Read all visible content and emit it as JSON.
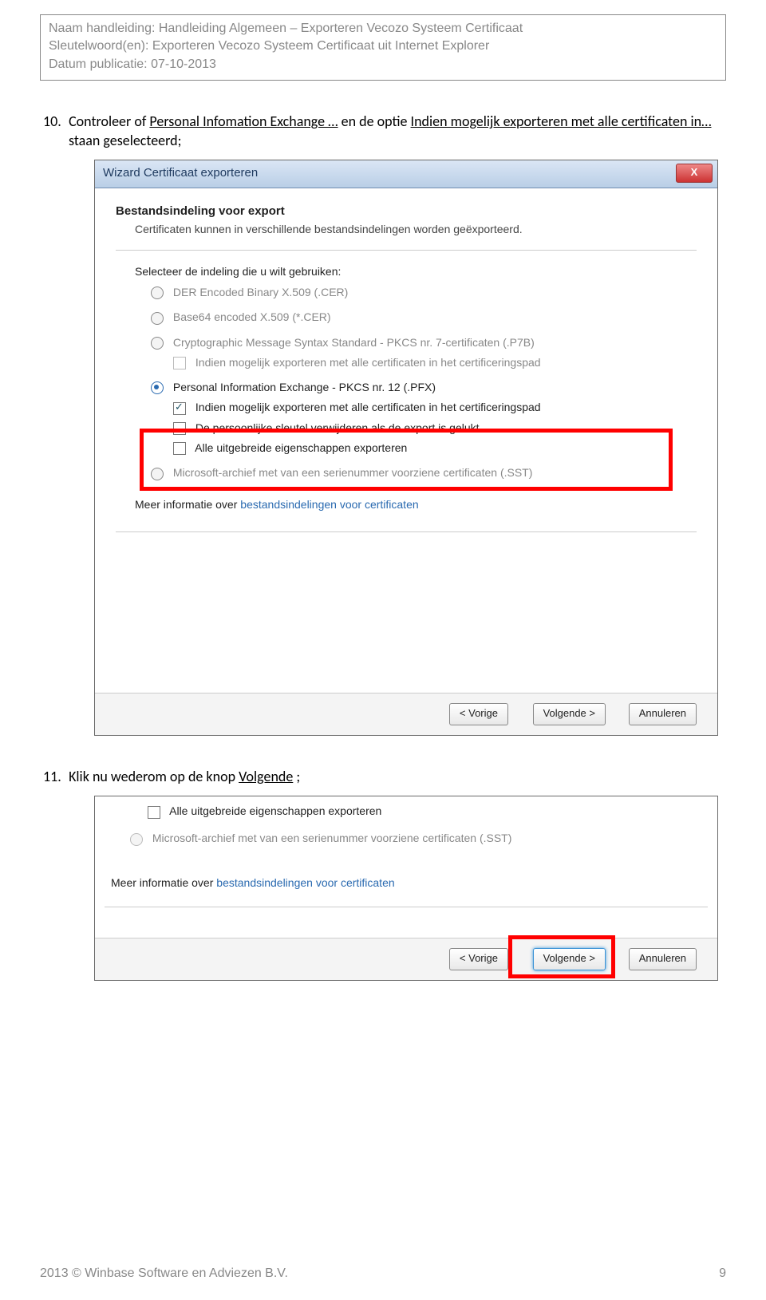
{
  "header": {
    "line1_label": "Naam handleiding:",
    "line1_value": "Handleiding Algemeen – Exporteren Vecozo Systeem Certificaat",
    "line2_label": "Sleutelwoord(en):",
    "line2_value": "Exporteren Vecozo Systeem Certificaat uit Internet Explorer",
    "line3_label": "Datum publicatie:",
    "line3_value": "07-10-2013"
  },
  "step10": {
    "num": "10.",
    "pre": "Controleer of ",
    "u1": "Personal Infomation Exchange …",
    "mid": " en de optie ",
    "u2": "Indien mogelijk exporteren met alle certificaten in…",
    "post": " staan geselecteerd;"
  },
  "dlg1": {
    "title": "Wizard Certificaat exporteren",
    "close": "X",
    "heading": "Bestandsindeling voor export",
    "desc": "Certificaten kunnen in verschillende bestandsindelingen worden geëxporteerd.",
    "select_label": "Selecteer de indeling die u wilt gebruiken:",
    "opt1": "DER Encoded Binary X.509 (.CER)",
    "opt2": "Base64 encoded X.509 (*.CER)",
    "opt3": "Cryptographic Message Syntax Standard - PKCS nr. 7-certificaten (.P7B)",
    "opt3_sub": "Indien mogelijk exporteren met alle certificaten in het certificeringspad",
    "opt4": "Personal Information Exchange - PKCS nr. 12 (.PFX)",
    "opt4_sub1": "Indien mogelijk exporteren met alle certificaten in het certificeringspad",
    "opt4_sub2": "De persoonlijke sleutel verwijderen als de export is gelukt",
    "opt4_sub3": "Alle uitgebreide eigenschappen exporteren",
    "opt5": "Microsoft-archief met van een serienummer voorziene certificaten (.SST)",
    "info_pre": "Meer informatie over ",
    "info_link": "bestandsindelingen voor certificaten",
    "btn_prev": "< Vorige",
    "btn_next": "Volgende >",
    "btn_cancel": "Annuleren"
  },
  "step11": {
    "num": "11.",
    "pre": "Klik nu wederom op de knop ",
    "u1": "Volgende",
    "post": ";"
  },
  "dlg2": {
    "chk1": "Alle uitgebreide eigenschappen exporteren",
    "opt1": "Microsoft-archief met van een serienummer voorziene certificaten (.SST)",
    "info_pre": "Meer informatie over ",
    "info_link": "bestandsindelingen voor certificaten",
    "btn_prev": "< Vorige",
    "btn_next": "Volgende >",
    "btn_cancel": "Annuleren"
  },
  "footer": {
    "left": "2013 © Winbase Software en Adviezen B.V.",
    "right": "9"
  }
}
